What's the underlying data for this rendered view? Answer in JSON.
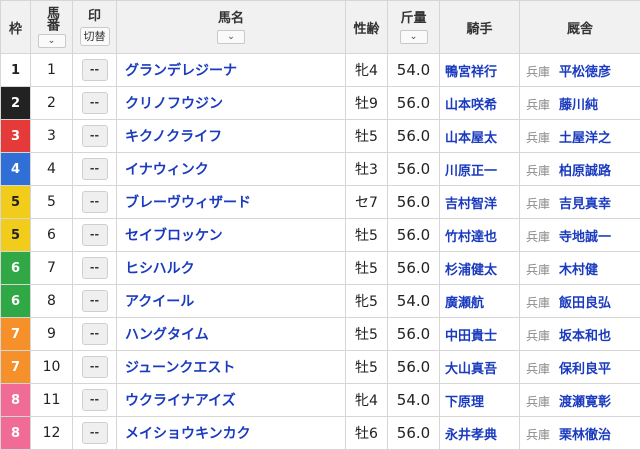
{
  "header": {
    "waku": "枠",
    "umaban": "馬番",
    "mark": "印",
    "toggle": "切替",
    "horse_name": "馬名",
    "sex_age": "性齢",
    "weight": "斤量",
    "jockey": "騎手",
    "trainer": "厩舎",
    "sort_glyph": "⌄"
  },
  "mark_placeholder": "--",
  "waku_colors": {
    "1": {
      "bg": "#ffffff",
      "fg": "#222222"
    },
    "2": {
      "bg": "#222222",
      "fg": "#ffffff"
    },
    "3": {
      "bg": "#e53a3a",
      "fg": "#ffffff"
    },
    "4": {
      "bg": "#2f6fd6",
      "fg": "#ffffff"
    },
    "5": {
      "bg": "#f2cc1a",
      "fg": "#222222"
    },
    "6": {
      "bg": "#2fa845",
      "fg": "#ffffff"
    },
    "7": {
      "bg": "#f5902a",
      "fg": "#ffffff"
    },
    "8": {
      "bg": "#f06b95",
      "fg": "#ffffff"
    }
  },
  "rows": [
    {
      "waku": "1",
      "uma": "1",
      "horse": "グランデレジーナ",
      "sexage": "牝4",
      "weight": "54.0",
      "jockey": "鴨宮祥行",
      "region": "兵庫",
      "trainer": "平松徳彦"
    },
    {
      "waku": "2",
      "uma": "2",
      "horse": "クリノフウジン",
      "sexage": "牡9",
      "weight": "56.0",
      "jockey": "山本咲希",
      "region": "兵庫",
      "trainer": "藤川純"
    },
    {
      "waku": "3",
      "uma": "3",
      "horse": "キクノクライフ",
      "sexage": "牡5",
      "weight": "56.0",
      "jockey": "山本屋太",
      "region": "兵庫",
      "trainer": "土屋洋之"
    },
    {
      "waku": "4",
      "uma": "4",
      "horse": "イナウィンク",
      "sexage": "牡3",
      "weight": "56.0",
      "jockey": "川原正一",
      "region": "兵庫",
      "trainer": "柏原誠路"
    },
    {
      "waku": "5",
      "uma": "5",
      "horse": "ブレーヴウィザード",
      "sexage": "セ7",
      "weight": "56.0",
      "jockey": "吉村智洋",
      "region": "兵庫",
      "trainer": "吉見真幸"
    },
    {
      "waku": "5",
      "uma": "6",
      "horse": "セイブロッケン",
      "sexage": "牡5",
      "weight": "56.0",
      "jockey": "竹村達也",
      "region": "兵庫",
      "trainer": "寺地誠一"
    },
    {
      "waku": "6",
      "uma": "7",
      "horse": "ヒシハルク",
      "sexage": "牡5",
      "weight": "56.0",
      "jockey": "杉浦健太",
      "region": "兵庫",
      "trainer": "木村健"
    },
    {
      "waku": "6",
      "uma": "8",
      "horse": "アクイール",
      "sexage": "牝5",
      "weight": "54.0",
      "jockey": "廣瀬航",
      "region": "兵庫",
      "trainer": "飯田良弘"
    },
    {
      "waku": "7",
      "uma": "9",
      "horse": "ハングタイム",
      "sexage": "牡5",
      "weight": "56.0",
      "jockey": "中田貴士",
      "region": "兵庫",
      "trainer": "坂本和也"
    },
    {
      "waku": "7",
      "uma": "10",
      "horse": "ジューンクエスト",
      "sexage": "牡5",
      "weight": "56.0",
      "jockey": "大山真吾",
      "region": "兵庫",
      "trainer": "保利良平"
    },
    {
      "waku": "8",
      "uma": "11",
      "horse": "ウクライナアイズ",
      "sexage": "牝4",
      "weight": "54.0",
      "jockey": "下原理",
      "region": "兵庫",
      "trainer": "渡瀬寛彰"
    },
    {
      "waku": "8",
      "uma": "12",
      "horse": "メイショウキンカク",
      "sexage": "牡6",
      "weight": "56.0",
      "jockey": "永井孝典",
      "region": "兵庫",
      "trainer": "栗林徹治"
    }
  ]
}
